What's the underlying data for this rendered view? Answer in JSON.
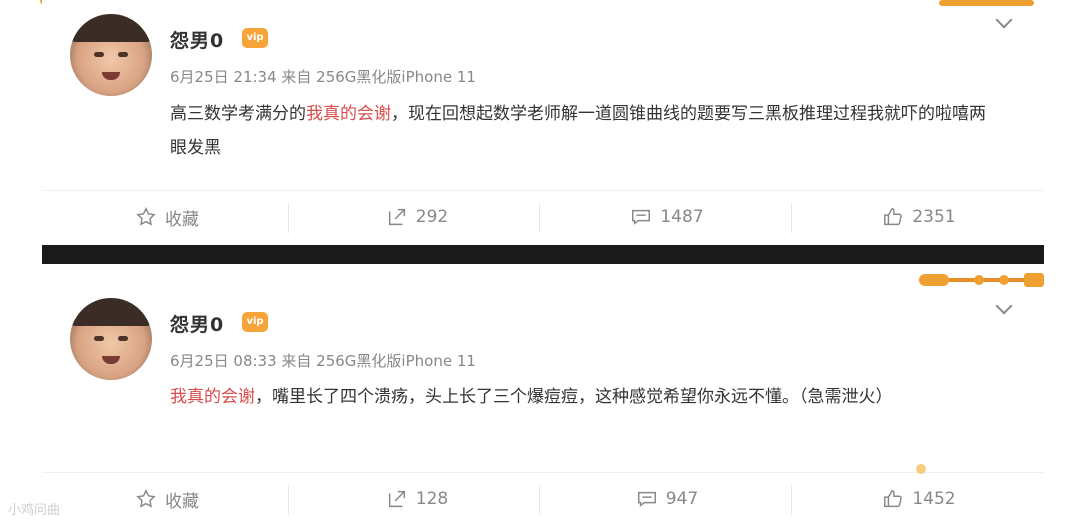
{
  "posts": [
    {
      "username": "怨男0",
      "vip_badge": "vip",
      "meta": "6月25日 21:34 来自 256G黑化版iPhone 11",
      "content_prefix": "高三数学考满分的",
      "content_highlight": "我真的会谢",
      "content_suffix": "，现在回想起数学老师解一道圆锥曲线的题要写三黑板推理过程我就吓的啦嘻两眼发黑",
      "actions": {
        "favorite_label": "收藏",
        "reposts": "292",
        "comments": "1487",
        "likes": "2351"
      }
    },
    {
      "username": "怨男0",
      "vip_badge": "vip",
      "meta": "6月25日 08:33 来自 256G黑化版iPhone 11",
      "content_prefix": "",
      "content_highlight": "我真的会谢",
      "content_suffix": "，嘴里长了四个溃疡，头上长了三个爆痘痘，这种感觉希望你永远不懂。（急需泄火）",
      "actions": {
        "favorite_label": "收藏",
        "reposts": "128",
        "comments": "947",
        "likes": "1452"
      }
    }
  ],
  "watermark": "小鸡问曲",
  "colors": {
    "highlight": "#d84c4c",
    "meta": "#888888",
    "vip": "#f6a43a",
    "divider": "#1a1a1a"
  },
  "icons": [
    "star-icon",
    "repost-icon",
    "comment-icon",
    "like-icon",
    "chevron-down-icon"
  ]
}
